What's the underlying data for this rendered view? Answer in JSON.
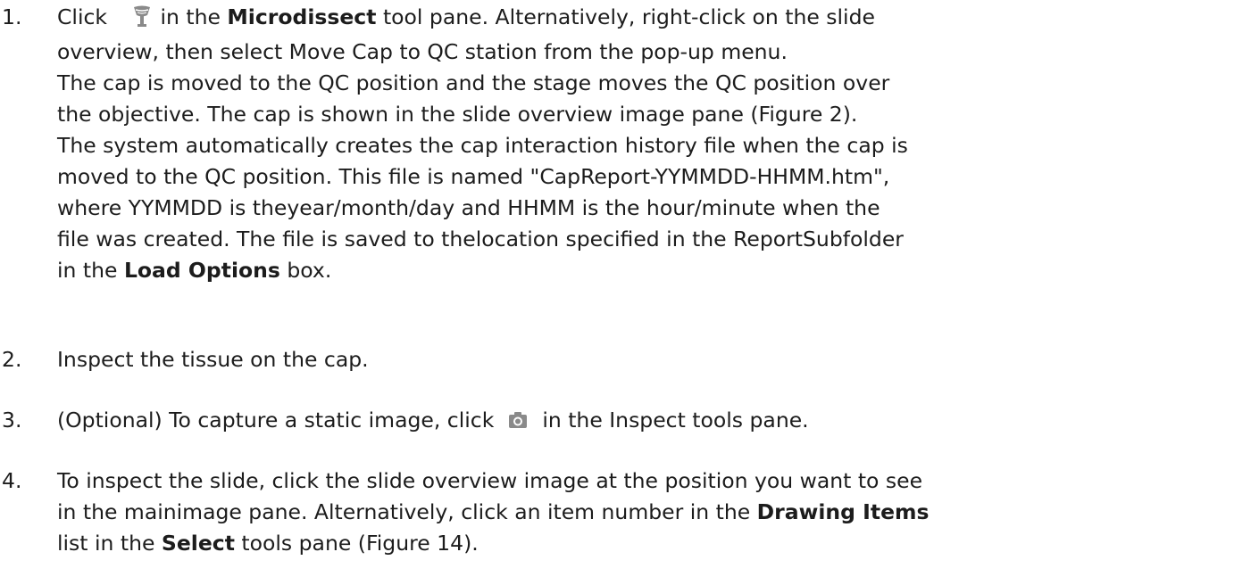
{
  "steps": [
    {
      "number": "1.",
      "line1": {
        "pre": "Click",
        "icon": "cap-qc-icon",
        "mid": " in the ",
        "bold": "Microdissect",
        "post": " tool pane. Alternatively, right-click on the slide"
      },
      "line2": "overview, then select Move Cap to QC station from the pop-up menu.",
      "para2": [
        "The cap is moved to the QC position and the stage moves the QC position over",
        "the objective. The cap is shown in the slide overview image pane (Figure 2)."
      ],
      "para3": [
        "The system automatically creates the cap interaction history file when the cap is",
        "moved to the QC position. This file is named \"CapReport-YYMMDD-HHMM.htm\",",
        "where YYMMDD is theyear/month/day and HHMM is the hour/minute when the",
        "file was created. The file is saved to thelocation specified in the ReportSubfolder"
      ],
      "last": {
        "pre": "in the ",
        "bold": "Load Options",
        "post": " box."
      }
    },
    {
      "number": "2.",
      "text": "Inspect the tissue on the cap."
    },
    {
      "number": "3.",
      "pre": "(Optional) To capture a static image, click",
      "icon": "camera-icon",
      "post": "in the Inspect tools pane."
    },
    {
      "number": "4.",
      "line1": "To inspect the slide, click the slide overview image at the position you want to see",
      "line2": {
        "pre": "in the mainimage pane. Alternatively, click an item number in the ",
        "bold": "Drawing Items"
      },
      "line3": {
        "pre": "list in the ",
        "bold": "Select",
        "post": " tools pane (Figure 14)."
      }
    }
  ],
  "colors": {
    "text": "#1c1c1c",
    "icon": "#8a8a8a"
  }
}
